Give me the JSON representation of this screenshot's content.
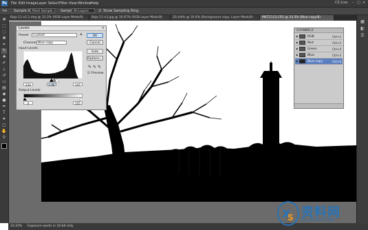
{
  "app": {
    "logo": "Ps"
  },
  "menubar": {
    "items": [
      "File",
      "Edit",
      "Image",
      "Layer",
      "Select",
      "Filter",
      "View",
      "Window",
      "Help"
    ],
    "right_text": "CS Live"
  },
  "optbar": {
    "sample_size_label": "Sample Size:",
    "sample_size_value": "Point Sample",
    "sample_label": "Sample:",
    "sample_value": "All Layers",
    "show_ring_label": "Show Sampling Ring"
  },
  "tabs": [
    {
      "label": "Bajo 12 e2.1.dng @ 33.3% (RGB Layer Mask/8)"
    },
    {
      "label": "Bajo 12 e3.jpg @ 16.67% (RGB Layer Mask/8)"
    },
    {
      "label": "20.4/dfs @ 16.6% (Background copy, Layer Mask/8)"
    },
    {
      "label": "MILT2113.CR2 @ 33.3% (Blue copy/8)",
      "active": true
    }
  ],
  "status": {
    "zoom": "33.33%",
    "info": "Exposure works in 32-bit only"
  },
  "levels": {
    "title": "Levels",
    "preset_label": "Preset:",
    "preset_value": "Custom",
    "channel_label": "Channel:",
    "channel_value": "Blue copy",
    "input_levels_label": "Input Levels:",
    "input_black": "124",
    "input_mid": "1.00",
    "input_white": "147",
    "output_levels_label": "Output Levels:",
    "output_black": "0",
    "output_white": "255",
    "buttons": {
      "ok": "OK",
      "cancel": "Cancel",
      "auto": "Auto",
      "options": "Options..."
    },
    "preview_label": "Preview",
    "preview_checked": true
  },
  "channels_panel": {
    "title": "CHANNELS",
    "rows": [
      {
        "name": "RGB",
        "key": "Ctrl+2"
      },
      {
        "name": "Red",
        "key": "Ctrl+3"
      },
      {
        "name": "Green",
        "key": "Ctrl+4"
      },
      {
        "name": "Blue",
        "key": "Ctrl+5"
      },
      {
        "name": "Blue copy",
        "key": "Ctrl+6",
        "selected": true
      }
    ]
  },
  "watermark": {
    "text": "资料网",
    "url": "ZL.XS1616.COM",
    "color": "#2b73b5"
  }
}
